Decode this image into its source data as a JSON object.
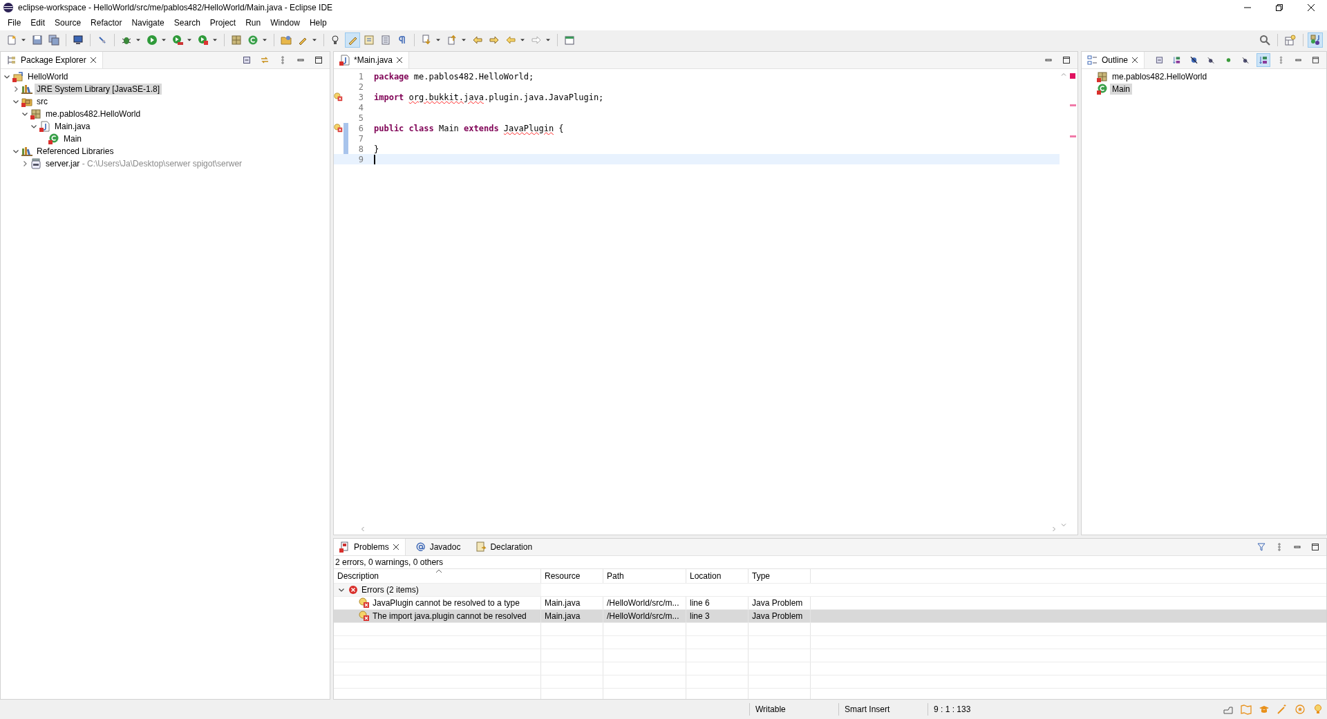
{
  "window": {
    "title": "eclipse-workspace - HelloWorld/src/me/pablos482/HelloWorld/Main.java - Eclipse IDE"
  },
  "menu": [
    "File",
    "Edit",
    "Source",
    "Refactor",
    "Navigate",
    "Search",
    "Project",
    "Run",
    "Window",
    "Help"
  ],
  "package_explorer": {
    "title": "Package Explorer",
    "tree": [
      {
        "label": "HelloWorld",
        "kind": "project",
        "expanded": true,
        "selected": false,
        "children": [
          {
            "label": "JRE System Library [JavaSE-1.8]",
            "kind": "library",
            "expanded": false,
            "selected": true
          },
          {
            "label": "src",
            "kind": "folder",
            "expanded": true,
            "selected": false,
            "children": [
              {
                "label": "me.pablos482.HelloWorld",
                "kind": "package",
                "expanded": true,
                "selected": false,
                "children": [
                  {
                    "label": "Main.java",
                    "kind": "java-file",
                    "expanded": true,
                    "selected": false,
                    "children": [
                      {
                        "label": "Main",
                        "kind": "class",
                        "selected": false
                      }
                    ]
                  }
                ]
              }
            ]
          },
          {
            "label": "Referenced Libraries",
            "kind": "library",
            "expanded": true,
            "selected": false,
            "children": [
              {
                "label": "server.jar",
                "detail": "- C:\\Users\\Ja\\Desktop\\serwer spigot\\serwer",
                "kind": "jar",
                "expanded": false,
                "selected": false
              }
            ]
          }
        ]
      }
    ]
  },
  "editor": {
    "tab": {
      "label": "*Main.java",
      "selected": true
    },
    "lines": [
      {
        "number": "1",
        "error": false,
        "changed": false,
        "current": false,
        "tokens": [
          {
            "kind": "keyword",
            "text": "package"
          },
          {
            "kind": "plain",
            "text": " me.pablos482.HelloWorld;"
          }
        ]
      },
      {
        "number": "2",
        "error": false,
        "changed": false,
        "current": false
      },
      {
        "number": "3",
        "error": true,
        "changed": false,
        "current": false,
        "tokens": [
          {
            "kind": "keyword",
            "text": "import "
          },
          {
            "kind": "error",
            "text": "org.bukkit.java"
          },
          {
            "kind": "plain",
            "text": ".plugin.java.JavaPlugin;"
          }
        ]
      },
      {
        "number": "4",
        "error": false,
        "changed": false,
        "current": false
      },
      {
        "number": "5",
        "error": false,
        "changed": false,
        "current": false
      },
      {
        "number": "6",
        "error": true,
        "changed": true,
        "current": false,
        "tokens": [
          {
            "kind": "keyword",
            "text": "public class"
          },
          {
            "kind": "plain",
            "text": " Main "
          },
          {
            "kind": "keyword",
            "text": "extends "
          },
          {
            "kind": "error",
            "text": "JavaPlugin"
          },
          {
            "kind": "plain",
            "text": " {"
          }
        ]
      },
      {
        "number": "7",
        "error": false,
        "changed": true,
        "current": false
      },
      {
        "number": "8",
        "error": false,
        "changed": true,
        "current": false,
        "tokens": [
          {
            "kind": "plain",
            "text": "}"
          }
        ]
      },
      {
        "number": "9",
        "error": false,
        "changed": false,
        "current": true
      }
    ]
  },
  "outline": {
    "title": "Outline",
    "items": [
      {
        "label": "me.pablos482.HelloWorld",
        "kind": "package",
        "selected": false
      },
      {
        "label": "Main",
        "kind": "class",
        "selected": true
      }
    ]
  },
  "bottom_panel": {
    "tabs": [
      {
        "label": "Problems",
        "selected": true
      },
      {
        "label": "Javadoc",
        "selected": false
      },
      {
        "label": "Declaration",
        "selected": false
      }
    ],
    "summary": "2 errors, 0 warnings, 0 others",
    "columns": [
      "Description",
      "Resource",
      "Path",
      "Location",
      "Type"
    ],
    "group": {
      "label": "Errors (2 items)",
      "expanded": true
    },
    "rows": [
      {
        "selected": false,
        "cells": [
          "JavaPlugin cannot be resolved to a type",
          "Main.java",
          "/HelloWorld/src/m...",
          "line 6",
          "Java Problem"
        ]
      },
      {
        "selected": true,
        "cells": [
          "The import java.plugin cannot be resolved",
          "Main.java",
          "/HelloWorld/src/m...",
          "line 3",
          "Java Problem"
        ]
      }
    ]
  },
  "status_bar": [
    "Writable",
    "Smart Insert",
    "9 : 1 : 133"
  ]
}
